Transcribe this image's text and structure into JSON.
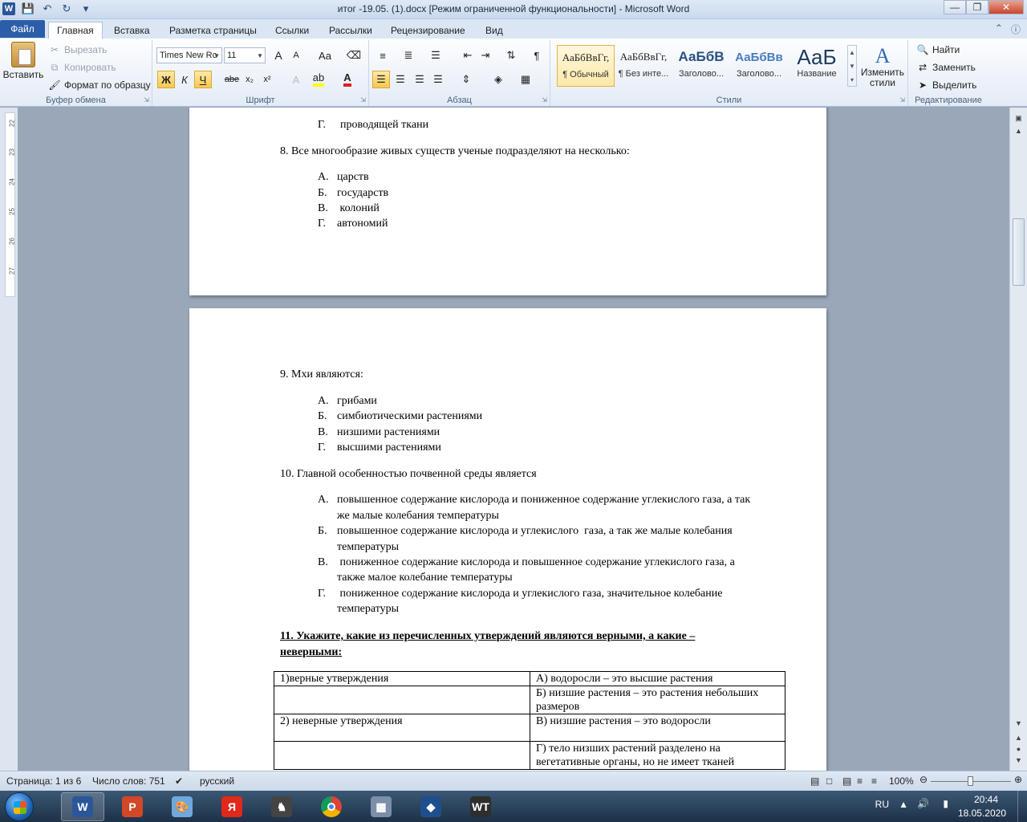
{
  "window": {
    "title": "итог -19.05. (1).docx [Режим ограниченной функциональности]  -  Microsoft Word",
    "app_icon": "W",
    "minimize": "—",
    "maximize": "❐",
    "close": "✕"
  },
  "tabs": {
    "file": "Файл",
    "items": [
      "Главная",
      "Вставка",
      "Разметка страницы",
      "Ссылки",
      "Рассылки",
      "Рецензирование",
      "Вид"
    ]
  },
  "ribbon": {
    "clipboard": {
      "label": "Буфер обмена",
      "paste": "Вставить",
      "cut": "Вырезать",
      "copy": "Копировать",
      "format_painter": "Формат по образцу"
    },
    "font": {
      "label": "Шрифт",
      "name": "Times New Rc",
      "size": "11",
      "bold": "Ж",
      "italic": "К",
      "underline": "Ч",
      "strike": "abe",
      "subscript": "x₂",
      "superscript": "x²",
      "grow": "A",
      "shrink": "A",
      "case": "Aa",
      "color_A": "A"
    },
    "paragraph": {
      "label": "Абзац",
      "pilcrow": "¶"
    },
    "styles": {
      "label": "Стили",
      "items": [
        {
          "preview": "АаБбВвГг,",
          "name": "¶ Обычный"
        },
        {
          "preview": "АаБбВвГг,",
          "name": "¶ Без инте..."
        },
        {
          "preview": "АаБбВ",
          "name": "Заголово..."
        },
        {
          "preview": "АаБбВв",
          "name": "Заголово..."
        },
        {
          "preview": "АаБ",
          "name": "Название"
        }
      ],
      "change": "Изменить стили"
    },
    "editing": {
      "label": "Редактирование",
      "find": "Найти",
      "replace": "Заменить",
      "select": "Выделить"
    }
  },
  "ruler": {
    "numbers": [
      "22",
      "23",
      "24",
      "25",
      "26",
      "27"
    ]
  },
  "document": {
    "page1": {
      "prev_option": {
        "letter": "Г.",
        "text": "проводящей ткани"
      },
      "q8": "8. Все многообразие живых существ ученые подразделяют на несколько:",
      "q8_options": [
        {
          "letter": "А.",
          "text": "царств"
        },
        {
          "letter": "Б.",
          "text": "государств"
        },
        {
          "letter": "В.",
          "text": " колоний"
        },
        {
          "letter": "Г.",
          "text": "автономий"
        }
      ]
    },
    "page2": {
      "q9": "9. Мхи являются:",
      "q9_options": [
        {
          "letter": "А.",
          "text": "грибами"
        },
        {
          "letter": "Б.",
          "text": "симбиотическими растениями"
        },
        {
          "letter": "В.",
          "text": "низшими растениями"
        },
        {
          "letter": "Г.",
          "text": "высшими растениями"
        }
      ],
      "q10": "10. Главной особенностью почвенной среды является",
      "q10_options": [
        {
          "letter": "А.",
          "line1": "повышенное содержание кислорода и пониженное содержание углекислого газа, а так",
          "line2": "же малые колебания температуры"
        },
        {
          "letter": "Б.",
          "line1": "повышенное содержание кислорода и углекислого  газа, а так же малые колебания",
          "line2": "температуры"
        },
        {
          "letter": "В.",
          "line1": " пониженное содержание кислорода и повышенное содержание углекислого газа, а",
          "line2": "также малое колебание температуры"
        },
        {
          "letter": "Г.",
          "line1": " пониженное содержание кислорода и углекислого газа, значительное колебание",
          "line2": "температуры"
        }
      ],
      "q11_line1": "11. Укажите, какие из перечисленных утверждений являются верными, а какие –",
      "q11_line2": "неверными:",
      "table": [
        [
          "1)верные утверждения",
          "А) водоросли – это высшие растения"
        ],
        [
          "",
          "Б) низшие растения – это растения небольших размеров"
        ],
        [
          "2) неверные утверждения",
          "В) низшие растения – это водоросли"
        ],
        [
          "",
          "Г) тело низших растений разделено на вегетативные органы, но не имеет тканей"
        ]
      ]
    }
  },
  "statusbar": {
    "page": "Страница: 1 из 6",
    "words": "Число слов: 751",
    "language": "русский",
    "zoom": "100%",
    "zoom_level": 0.5
  },
  "taskbar": {
    "apps": [
      {
        "name": "word",
        "glyph": "W",
        "color": "#2b579a"
      },
      {
        "name": "powerpoint",
        "glyph": "P",
        "color": "#d24726"
      },
      {
        "name": "paint",
        "glyph": "🎨",
        "color": "#6fa8dc"
      },
      {
        "name": "yandex",
        "glyph": "Я",
        "color": "#e0291b"
      },
      {
        "name": "chess",
        "glyph": "♞",
        "color": "#444444"
      },
      {
        "name": "chrome",
        "glyph": "",
        "color": "#ffffff"
      },
      {
        "name": "calculator",
        "glyph": "▦",
        "color": "#7b8fa8"
      },
      {
        "name": "game-launcher",
        "glyph": "◆",
        "color": "#1f4e8c"
      },
      {
        "name": "world-of-tanks",
        "glyph": "WT",
        "color": "#2e2e2e"
      }
    ],
    "lang": "RU",
    "time": "20:44",
    "date": "18.05.2020"
  },
  "colors": {
    "file_tab": "#2a5ea8",
    "doc_bg": "#9aa7b8",
    "taskbar": "#1d3147"
  }
}
